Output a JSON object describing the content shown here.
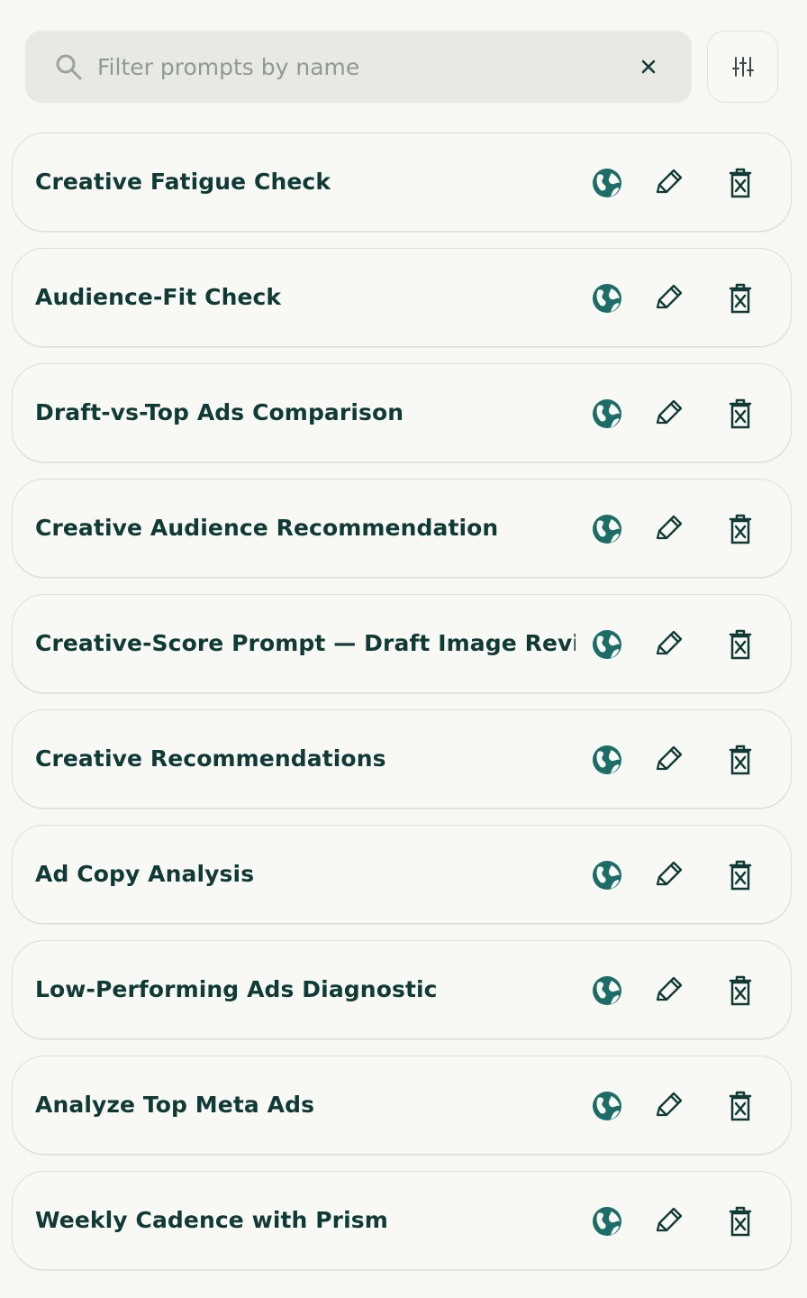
{
  "search": {
    "placeholder": "Filter prompts by name",
    "value": ""
  },
  "actions": {
    "clear_icon": "close-icon",
    "filter_icon": "sliders-icon"
  },
  "prompts": [
    {
      "title": "Creative Fatigue Check",
      "visibility_icon": "globe-icon",
      "edit_icon": "pencil-icon",
      "delete_icon": "trash-x-icon"
    },
    {
      "title": "Audience-Fit Check",
      "visibility_icon": "globe-icon",
      "edit_icon": "pencil-icon",
      "delete_icon": "trash-x-icon"
    },
    {
      "title": "Draft-vs-Top Ads Comparison",
      "visibility_icon": "globe-icon",
      "edit_icon": "pencil-icon",
      "delete_icon": "trash-x-icon"
    },
    {
      "title": "Creative Audience Recommendation",
      "visibility_icon": "globe-icon",
      "edit_icon": "pencil-icon",
      "delete_icon": "trash-x-icon"
    },
    {
      "title": "Creative-Score Prompt — Draft Image Review",
      "visibility_icon": "globe-icon",
      "edit_icon": "pencil-icon",
      "delete_icon": "trash-x-icon"
    },
    {
      "title": "Creative Recommendations",
      "visibility_icon": "globe-icon",
      "edit_icon": "pencil-icon",
      "delete_icon": "trash-x-icon"
    },
    {
      "title": "Ad Copy Analysis",
      "visibility_icon": "globe-icon",
      "edit_icon": "pencil-icon",
      "delete_icon": "trash-x-icon"
    },
    {
      "title": "Low-Performing Ads Diagnostic",
      "visibility_icon": "globe-icon",
      "edit_icon": "pencil-icon",
      "delete_icon": "trash-x-icon"
    },
    {
      "title": "Analyze Top Meta Ads",
      "visibility_icon": "globe-icon",
      "edit_icon": "pencil-icon",
      "delete_icon": "trash-x-icon"
    },
    {
      "title": "Weekly Cadence with Prism",
      "visibility_icon": "globe-icon",
      "edit_icon": "pencil-icon",
      "delete_icon": "trash-x-icon"
    }
  ],
  "colors": {
    "background": "#f7f8f4",
    "text": "#103a36",
    "globe": "#1c6d68",
    "search_background": "#e9e9e3",
    "placeholder": "#8f9995",
    "card_border": "#d9dfdb"
  }
}
